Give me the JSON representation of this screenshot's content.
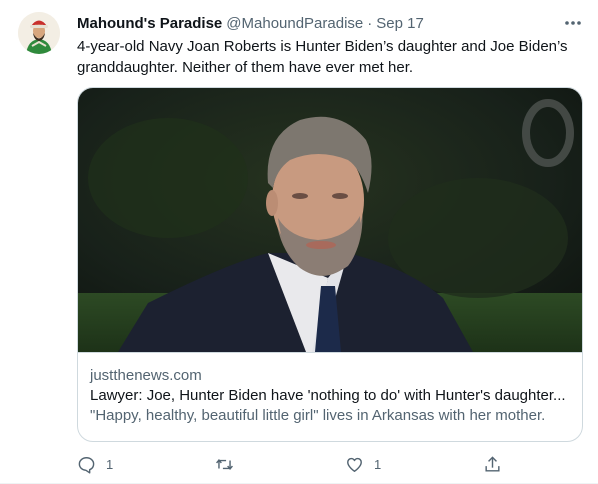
{
  "tweet": {
    "author_name": "Mahound's Paradise",
    "author_handle": "@MahoundParadise",
    "separator": "·",
    "timestamp": "Sep 17",
    "text": "4-year-old Navy Joan Roberts is Hunter Biden’s daughter and Joe Biden’s granddaughter. Neither of them have ever met her."
  },
  "card": {
    "domain": "justthenews.com",
    "title": "Lawyer: Joe, Hunter Biden have 'nothing to do' with Hunter's daughter...",
    "description": "\"Happy, healthy, beautiful little girl\" lives in Arkansas with her mother."
  },
  "actions": {
    "reply_count": "1",
    "retweet_count": "",
    "like_count": "1"
  },
  "icons": {
    "more": "more-icon",
    "reply": "reply-icon",
    "retweet": "retweet-icon",
    "like": "like-icon",
    "share": "share-icon"
  },
  "colors": {
    "text_primary": "#0f1419",
    "text_secondary": "#536471",
    "border": "#cfd9de"
  }
}
